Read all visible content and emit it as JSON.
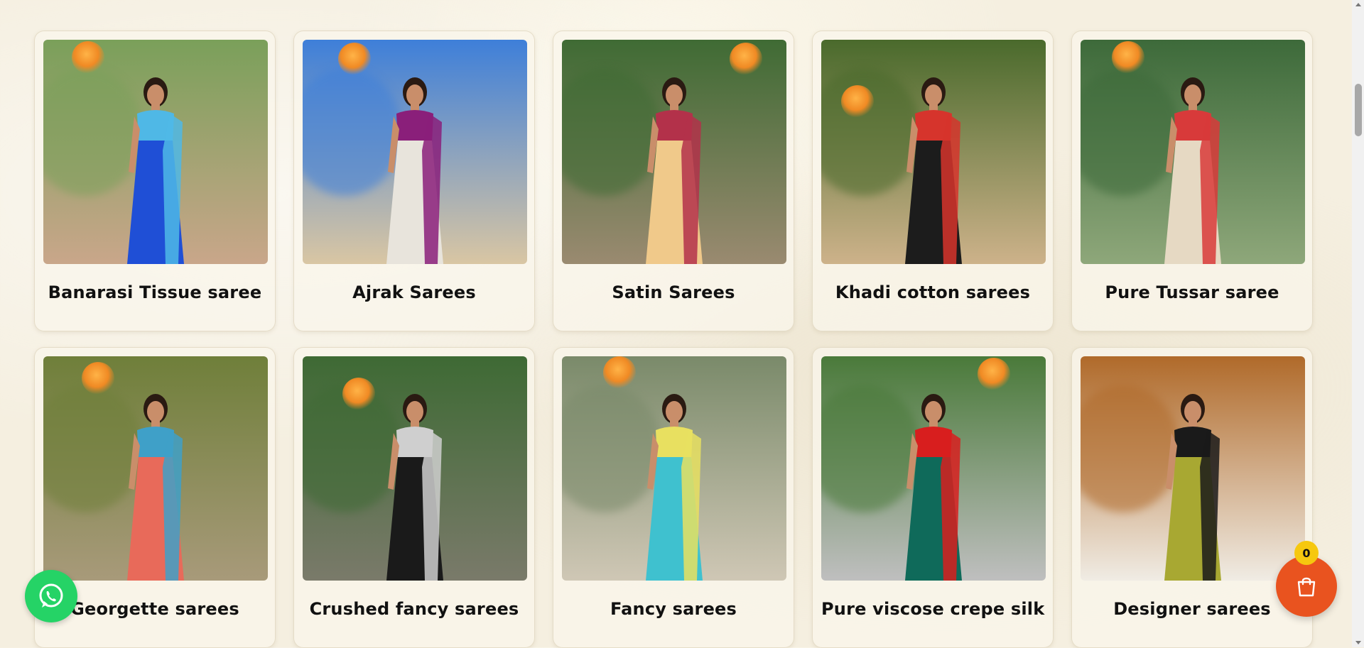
{
  "categories": [
    {
      "label": "Banarasi Tissue saree",
      "bg": [
        "#7aa05a",
        "#c9a68a"
      ],
      "saree": "#1f4fd6",
      "accent": "#4fb8e6"
    },
    {
      "label": "Ajrak Sarees",
      "bg": [
        "#3e7fd9",
        "#d9c6a3"
      ],
      "saree": "#e8e4dc",
      "accent": "#8a1f7a"
    },
    {
      "label": "Satin Sarees",
      "bg": [
        "#3f6b34",
        "#9a8a70"
      ],
      "saree": "#f0c98a",
      "accent": "#b3314a"
    },
    {
      "label": "Khadi cotton sarees",
      "bg": [
        "#4a6a2c",
        "#cdb28a"
      ],
      "saree": "#1c1c1c",
      "accent": "#d6342c"
    },
    {
      "label": "Pure Tussar saree",
      "bg": [
        "#3d6a3a",
        "#8ea77a"
      ],
      "saree": "#e6d9c3",
      "accent": "#d83a3a"
    },
    {
      "label": "Georgette sarees",
      "bg": [
        "#6f7f3a",
        "#a89a7a"
      ],
      "saree": "#e86a5a",
      "accent": "#3fa0c8"
    },
    {
      "label": "Crushed fancy sarees",
      "bg": [
        "#3e6a34",
        "#7a7a6a"
      ],
      "saree": "#1a1a1a",
      "accent": "#cfcfcf"
    },
    {
      "label": "Fancy sarees",
      "bg": [
        "#7a8a6a",
        "#cfc7b5"
      ],
      "saree": "#3fc1cf",
      "accent": "#e8e060"
    },
    {
      "label": "Pure viscose crepe silk",
      "bg": [
        "#4a7a3a",
        "#bfbfbf"
      ],
      "saree": "#0f6a5a",
      "accent": "#d81e1e"
    },
    {
      "label": "Designer sarees",
      "bg": [
        "#b06a2a",
        "#f0ece4"
      ],
      "saree": "#a8a832",
      "accent": "#1a1a1a"
    }
  ],
  "cart": {
    "count": "0"
  },
  "icons": {
    "whatsapp": "whatsapp-icon",
    "cart": "shopping-bag-icon"
  },
  "colors": {
    "whatsapp": "#25d366",
    "cart": "#e9531f",
    "badge": "#f6c80f"
  }
}
